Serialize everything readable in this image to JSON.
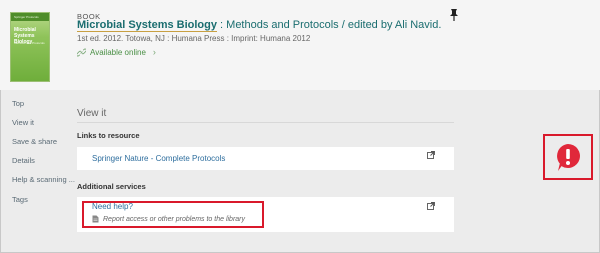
{
  "record": {
    "type": "BOOK",
    "title_main": "Microbial Systems Biology",
    "title_rest": " : Methods and Protocols / edited by Ali Navid.",
    "publication": "1st ed. 2012. Totowa, NJ : Humana Press : Imprint: Humana 2012",
    "availability": "Available online",
    "availability_chevron": "›",
    "cover": {
      "band_text": "Springer Protocols",
      "title": "Microbial Systems Biology",
      "subtitle": "Methods and Protocols"
    }
  },
  "sidenav": {
    "items": [
      {
        "label": "Top"
      },
      {
        "label": "View it"
      },
      {
        "label": "Save & share"
      },
      {
        "label": "Details"
      },
      {
        "label": "Help & scanning ..."
      },
      {
        "label": "Tags"
      }
    ]
  },
  "main": {
    "heading": "View it",
    "links_label": "Links to resource",
    "link_text": "Springer Nature - Complete Protocols",
    "services_label": "Additional services",
    "help_title": "Need help?",
    "help_sub": "Report access or other problems to the library"
  },
  "colors": {
    "link": "#2e6e9e",
    "title": "#1a6d6f",
    "available": "#4a8f45",
    "highlight_box": "#d9192b",
    "alert": "#e0283a"
  },
  "icons": {
    "pin": "pin-icon",
    "link": "link-icon",
    "external": "external-link-icon",
    "document": "document-icon",
    "alert": "alert-exclamation-icon"
  }
}
